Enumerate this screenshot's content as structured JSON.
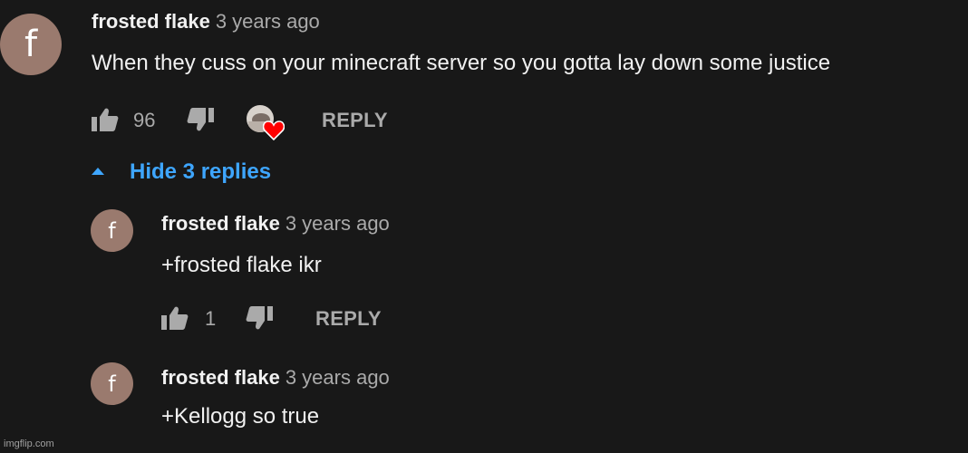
{
  "comment": {
    "avatar_letter": "f",
    "author": "frosted flake",
    "time": "3 years ago",
    "text": "When they cuss on your minecraft server so you gotta lay down some justice",
    "likes": "96",
    "reply_label": "REPLY",
    "heart_icon": "heart-icon",
    "accent_heart": "#ff0000"
  },
  "replies_toggle": {
    "label": "Hide 3 replies",
    "color": "#3ea6ff"
  },
  "replies": [
    {
      "avatar_letter": "f",
      "author": "frosted flake",
      "time": "3 years ago",
      "text": "+frosted flake ikr",
      "likes": "1",
      "reply_label": "REPLY"
    },
    {
      "avatar_letter": "f",
      "author": "frosted flake",
      "time": "3 years ago",
      "text": "+Kellogg so true"
    }
  ],
  "watermark": "imgflip.com"
}
